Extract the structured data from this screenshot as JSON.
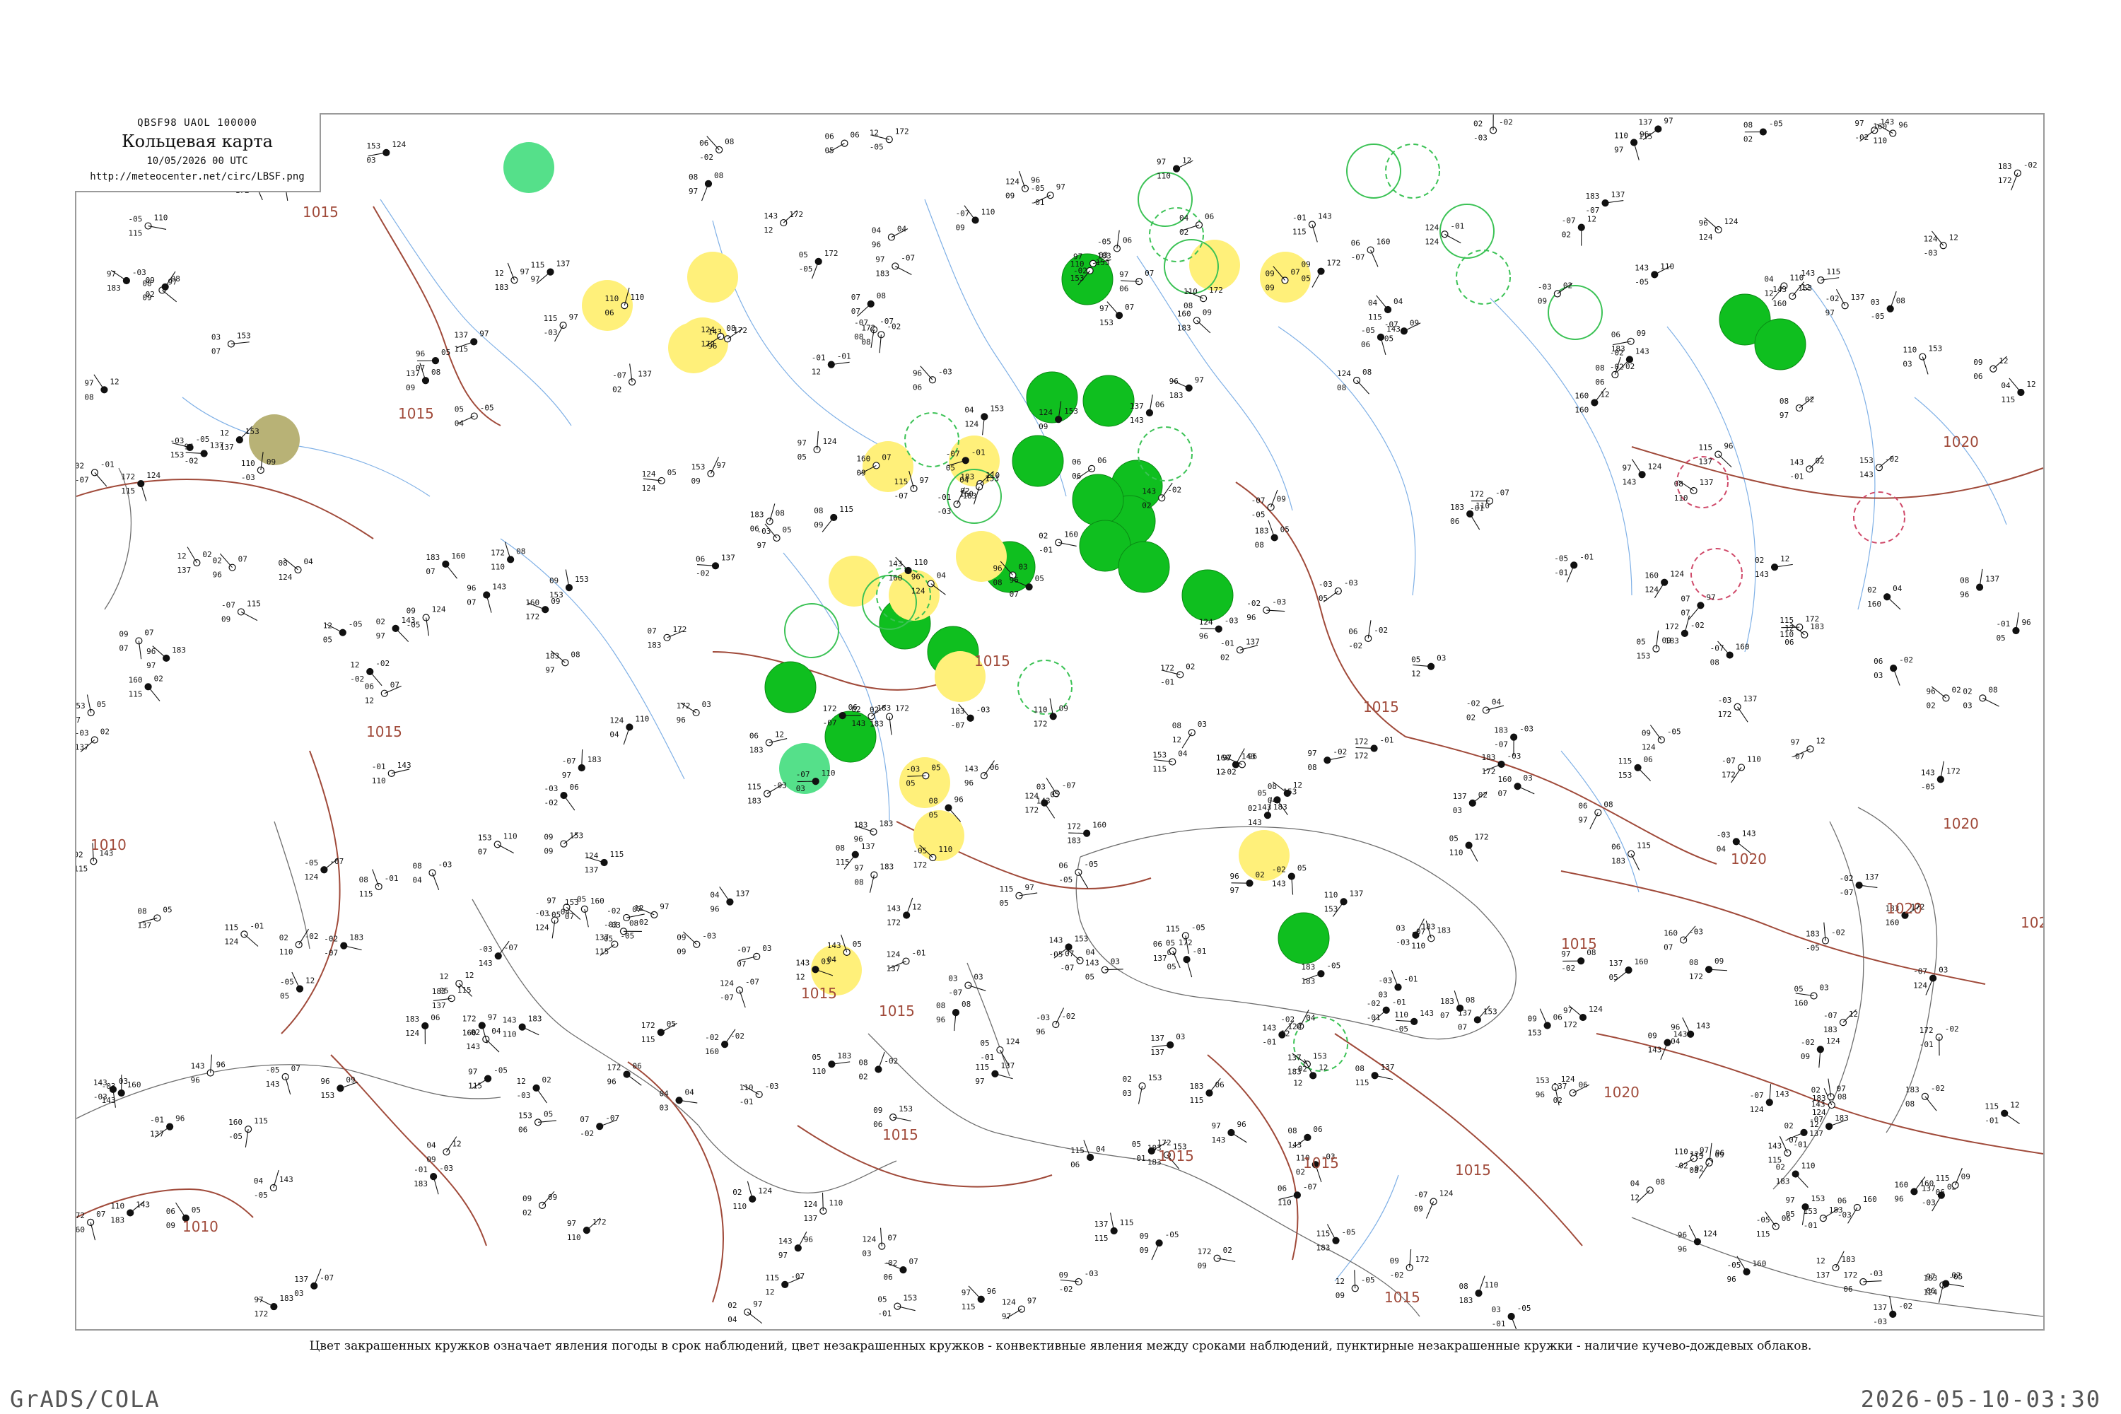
{
  "header": {
    "code": "QBSF98  UAOL  100000",
    "title": "Кольцевая карта",
    "datetime": "10/05/2026 00 UTC",
    "url": "http://meteocenter.net/circ/LBSF.png"
  },
  "caption": "Цвет закрашенных кружков означает явления погоды в срок наблюдений, цвет незакрашенных кружков - конвективные явления между сроками наблюдений, пунктирные незакрашенные кружки - наличие кучево-дождевых облаков.",
  "footer": {
    "software": "GrADS/COLA",
    "timestamp": "2026-05-10-03:30"
  },
  "colors": {
    "background": "#ffffff",
    "frame": "#9a9a9a",
    "isobar": "#a04a3a",
    "river": "#7fb0e6",
    "coast": "#6f6f6f",
    "rain_dark": "#0fbf1f",
    "rain_light": "#55e08a",
    "fog_yellow": "#fff07a",
    "haze_olive": "#b8b276",
    "convective_ring": "#3bc255",
    "thunder_ring": "#d04a6a"
  },
  "isobar_labels": [
    "1015",
    "1015",
    "1015",
    "1015",
    "1015",
    "1015",
    "1015",
    "1015",
    "1015",
    "1015",
    "1015",
    "1015",
    "1010",
    "1010",
    "1020",
    "1020",
    "1020",
    "1020",
    "1020",
    "1020",
    "1015",
    "102"
  ],
  "markers": {
    "filled_green": 18,
    "filled_yellow": 16,
    "open_green": 16,
    "open_red": 3
  }
}
